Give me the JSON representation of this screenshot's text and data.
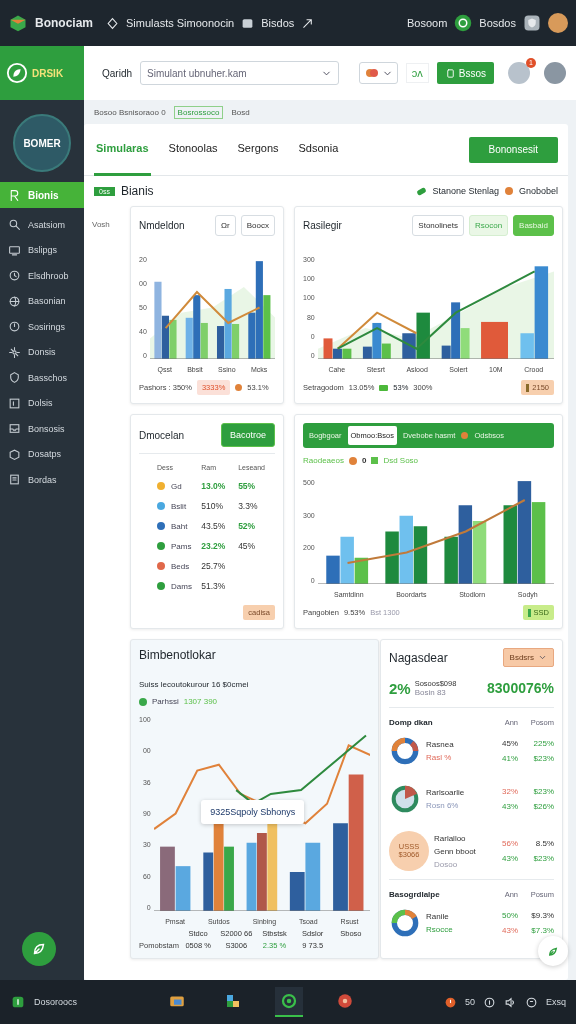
{
  "top_bar": {
    "app_name": "Bonociam",
    "nav": [
      "Simulasts Simoonocin",
      "Bisdos"
    ],
    "account_label": "Bosoom",
    "status_label": "Bosdos"
  },
  "sidebar": {
    "brand": "DRSIK",
    "logo_text": "BOMER",
    "items": [
      {
        "label": "Bionis",
        "selected": true
      },
      {
        "label": "Asatsiom",
        "selected": false
      },
      {
        "label": "Bslipgs",
        "selected": false
      },
      {
        "label": "Elsdhroob",
        "selected": false
      },
      {
        "label": "Basonian",
        "selected": false
      },
      {
        "label": "Sosirings",
        "selected": false
      },
      {
        "label": "Donsis",
        "selected": false
      },
      {
        "label": "Basschos",
        "selected": false
      },
      {
        "label": "Dolsis",
        "selected": false
      },
      {
        "label": "Bonsosis",
        "selected": false
      },
      {
        "label": "Dosatps",
        "selected": false
      },
      {
        "label": "Bordas",
        "selected": false
      }
    ]
  },
  "header": {
    "search_label": "Qaridh",
    "search_value": "Simulant ubnuher.kam",
    "shortcut": "ɔʌ",
    "action_button": "Bssos",
    "notification_count": "1"
  },
  "breadcrumb": [
    {
      "label": "Bosoo Bsnisoraoo 0",
      "selected": false
    },
    {
      "label": "Bosrossoco",
      "selected": true
    },
    {
      "label": "Bosd",
      "selected": false
    }
  ],
  "tabs": [
    {
      "label": "Simularas",
      "selected": true
    },
    {
      "label": "Stonoolas",
      "selected": false
    },
    {
      "label": "Sergons",
      "selected": false
    },
    {
      "label": "Sdsonia",
      "selected": false
    }
  ],
  "primary_button": "Bononsesit",
  "section": {
    "badge": "0ss",
    "title": "Bianis",
    "side_label": "Vosh",
    "legend": [
      {
        "label": "Stanone Stenlag",
        "color": "#2e9e3e"
      },
      {
        "label": "Gnobobel",
        "color": "#e0823a"
      }
    ]
  },
  "cards": [
    {
      "kind": "chart",
      "title": "Nmdeldon",
      "buttons": [
        {
          "label": "Ωr",
          "kind": "plain"
        },
        {
          "label": "Boocx",
          "kind": "plain"
        }
      ],
      "y_ticks": [
        "20",
        "00",
        "50",
        "40",
        "0"
      ],
      "categories": [
        "Qsst",
        "Bbsit",
        "Ssino",
        "Mcks"
      ],
      "footer": [
        {
          "text": "Pashors : 350%",
          "kind": "plain"
        },
        {
          "text": "3333%",
          "kind": "red_tag"
        },
        {
          "text": "53.1%",
          "kind": "orange_dot"
        }
      ]
    },
    {
      "kind": "chart",
      "title": "Rasilegir",
      "buttons": [
        {
          "label": "Stonolinets",
          "kind": "plain"
        },
        {
          "label": "Rsocon",
          "kind": "soft"
        },
        {
          "label": "Basbaid",
          "kind": "solid"
        }
      ],
      "y_ticks": [
        "300",
        "100",
        "100",
        "80",
        "0",
        "0"
      ],
      "categories": [
        "Cahe",
        "Stesrt",
        "Aslood",
        "Solert",
        "10M",
        "Crood"
      ],
      "footer": [
        {
          "text": "Setragodom",
          "kind": "plain"
        },
        {
          "text": "13.05%",
          "kind": "plain"
        },
        {
          "text": "53%",
          "kind": "green_marker"
        },
        {
          "text": "300%",
          "kind": "plain"
        },
        {
          "text": "2150",
          "kind": "orange_tag"
        }
      ]
    },
    {
      "kind": "table",
      "title": "Dmocelan",
      "button": "Bacotroe",
      "label_header": "Dess",
      "columns": [
        "Ram",
        "Leseand"
      ],
      "rows": [
        {
          "label": "Gd",
          "color": "#f0b030",
          "cells": [
            {
              "text": "13.0%",
              "kind": "positive"
            },
            {
              "text": "55%",
              "kind": "positive"
            }
          ]
        },
        {
          "label": "Bslit",
          "color": "#4aa8e0",
          "cells": [
            {
              "text": "510%",
              "kind": "neutral"
            },
            {
              "text": "3.3%",
              "kind": "neutral"
            }
          ]
        },
        {
          "label": "Baht",
          "color": "#2e6fb8",
          "cells": [
            {
              "text": "43.5%",
              "kind": "neutral"
            },
            {
              "text": "52%",
              "kind": "positive"
            }
          ]
        },
        {
          "label": "Pams",
          "color": "#2e9e3e",
          "cells": [
            {
              "text": "23.2%",
              "kind": "positive"
            },
            {
              "text": "45%",
              "kind": "neutral"
            }
          ]
        },
        {
          "label": "Beds",
          "color": "#e0684a",
          "cells": [
            {
              "text": "25.7%",
              "kind": "neutral"
            }
          ]
        },
        {
          "label": "Dams",
          "color": "#2e9e3e",
          "cells": [
            {
              "text": "51.3%",
              "kind": "neutral"
            }
          ]
        }
      ],
      "tag": "cadisa"
    },
    {
      "kind": "segmented_chart",
      "segments": [
        {
          "label": "Bogbgoar",
          "selected": false
        },
        {
          "label": "Obmoo:Bsos",
          "selected": true
        },
        {
          "label": "Dvebobe hasmt",
          "selected": false
        },
        {
          "label": "Odsbsos",
          "selected": false
        }
      ],
      "legend_title": "Raodeaeos",
      "legend": [
        {
          "label": "0",
          "color": "#e0823a"
        },
        {
          "label": "Dsd Soso",
          "color": "#5cc04a"
        }
      ],
      "y_ticks": [
        "500",
        "300",
        "200",
        "0"
      ],
      "categories": [
        "Samtdinn",
        "Boordarts",
        "Stodlorn",
        "Sodyh"
      ],
      "footer": [
        {
          "text": "Pangobien",
          "kind": "plain"
        },
        {
          "text": "9.53%",
          "kind": "plain"
        },
        {
          "text": "Bst 1300",
          "kind": "muted"
        },
        {
          "text": "SSD",
          "kind": "lime_tag"
        }
      ]
    },
    {
      "kind": "map_chart",
      "title": "Bimbenotlokar",
      "subtitle": "Suiss lecoutokurour 16 $0cmei",
      "legend": [
        {
          "label": "Parhssi",
          "color": "#3aa84a"
        }
      ],
      "legend_value": "1307 390",
      "y_ticks": [
        "100",
        "00",
        "36",
        "90",
        "30",
        "60",
        "0"
      ],
      "tooltip": "9325Sqpoly Sbhonys",
      "categories": [
        "Pmsat",
        "Sutdos",
        "Sinbing",
        "Tsoad",
        "Rsust"
      ],
      "value_rows": [
        {
          "cells": [
            {
              "text": "Stdco",
              "kind": "neutral"
            },
            {
              "text": "S2000 66",
              "kind": "neutral"
            },
            {
              "text": "Stbstsk",
              "kind": "neutral"
            },
            {
              "text": "Sdslor",
              "kind": "neutral"
            },
            {
              "text": "Sboso",
              "kind": "neutral"
            }
          ]
        },
        {
          "label": "Pomobstam",
          "cells": [
            {
              "text": "0508 %",
              "kind": "neutral"
            },
            {
              "text": "S3006",
              "kind": "neutral"
            },
            {
              "text": "2.35 %",
              "kind": "positive"
            },
            {
              "text": "9 73.5",
              "kind": "neutral"
            }
          ]
        }
      ]
    },
    {
      "kind": "summary",
      "title": "Nagasdear",
      "dropdown": "Bsdsrs",
      "change": "2%",
      "caption": "Sosoos$098",
      "sub_caption": "Bosin 83",
      "total": "8300076%",
      "groups": [
        {
          "title": "Domp dkan",
          "columns": [
            "Ann",
            "Posom"
          ],
          "rows": [
            {
              "kind": "donut",
              "name": "Rasnea",
              "detail": {
                "text": "Rasl %",
                "kind": "negative"
              },
              "values": [
                {
                  "text": "45%",
                  "kind": "neutral"
                },
                {
                  "text": "225%",
                  "kind": "positive"
                },
                {
                  "text": "41%",
                  "kind": "positive"
                },
                {
                  "text": "$23%",
                  "kind": "positive"
                }
              ]
            },
            {
              "kind": "pie",
              "name": "Rarlsoarlie",
              "detail": {
                "text": "Rosn 6%",
                "kind": "muted"
              },
              "values": [
                {
                  "text": "32%",
                  "kind": "negative"
                },
                {
                  "text": "$23%",
                  "kind": "positive"
                },
                {
                  "text": "43%",
                  "kind": "positive"
                },
                {
                  "text": "$26%",
                  "kind": "positive"
                }
              ]
            },
            {
              "kind": "badge",
              "badge_text": "USSS $3066",
              "name": "Rarlalloo",
              "detail": {
                "text": "Genn bboot",
                "kind": "neutral"
              },
              "extra": "Dosoo",
              "values": [
                {
                  "text": "56%",
                  "kind": "negative"
                },
                {
                  "text": "8.5%",
                  "kind": "neutral"
                },
                {
                  "text": "43%",
                  "kind": "positive"
                },
                {
                  "text": "$23%",
                  "kind": "positive"
                }
              ]
            }
          ]
        },
        {
          "title": "Basogrdlalpe",
          "columns": [
            "Ann",
            "Posum"
          ],
          "rows": [
            {
              "kind": "ring",
              "name": "Ranile",
              "detail": {
                "text": "Rsocce",
                "kind": "positive"
              },
              "values": [
                {
                  "text": "50%",
                  "kind": "positive"
                },
                {
                  "text": "$9.3%",
                  "kind": "neutral"
                },
                {
                  "text": "43%",
                  "kind": "negative"
                },
                {
                  "text": "$7.3%",
                  "kind": "positive"
                }
              ]
            }
          ]
        }
      ]
    }
  ],
  "taskbar": {
    "start_label": "Dosoroocs",
    "apps": [
      {
        "selected": false
      },
      {
        "selected": false
      },
      {
        "selected": true
      },
      {
        "selected": false
      }
    ],
    "tray_count": "50",
    "tray_label": "Exsq"
  }
}
